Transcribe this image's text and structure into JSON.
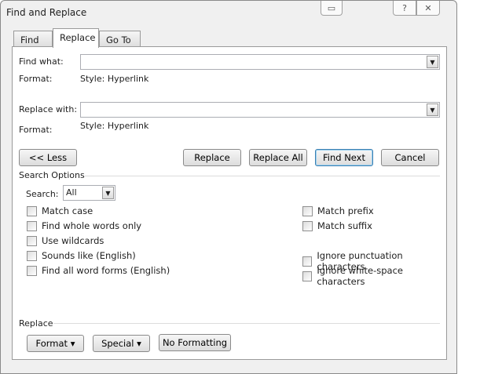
{
  "window": {
    "title": "Find and Replace",
    "help": "?",
    "close": "✕",
    "restore_icon": "window-icon"
  },
  "tabs": [
    {
      "label": "Find"
    },
    {
      "label": "Replace",
      "active": true
    },
    {
      "label": "Go To"
    }
  ],
  "find": {
    "label": "Find what:",
    "value": "",
    "format_label": "Format:",
    "format_value": "Style: Hyperlink"
  },
  "replace": {
    "label": "Replace with:",
    "value": "",
    "format_label": "Format:",
    "format_value": "Style: Hyperlink"
  },
  "buttons": {
    "less": "<< Less",
    "replace": "Replace",
    "replace_all": "Replace All",
    "find_next": "Find Next",
    "cancel": "Cancel"
  },
  "search_options": {
    "title": "Search Options",
    "search_label": "Search:",
    "search_value": "All"
  },
  "options_left": [
    {
      "label": "Match case",
      "checked": false
    },
    {
      "label": "Find whole words only",
      "checked": false
    },
    {
      "label": "Use wildcards",
      "checked": false
    },
    {
      "label": "Sounds like (English)",
      "checked": false
    },
    {
      "label": "Find all word forms (English)",
      "checked": false
    }
  ],
  "options_right": [
    {
      "label": "Match prefix",
      "checked": false
    },
    {
      "label": "Match suffix",
      "checked": false
    },
    {
      "label": "Ignore punctuation characters",
      "checked": false
    },
    {
      "label": "Ignore white-space characters",
      "checked": false
    }
  ],
  "replace_section": {
    "title": "Replace",
    "format": "Format ▾",
    "special": "Special ▾",
    "no_formatting": "No Formatting"
  }
}
